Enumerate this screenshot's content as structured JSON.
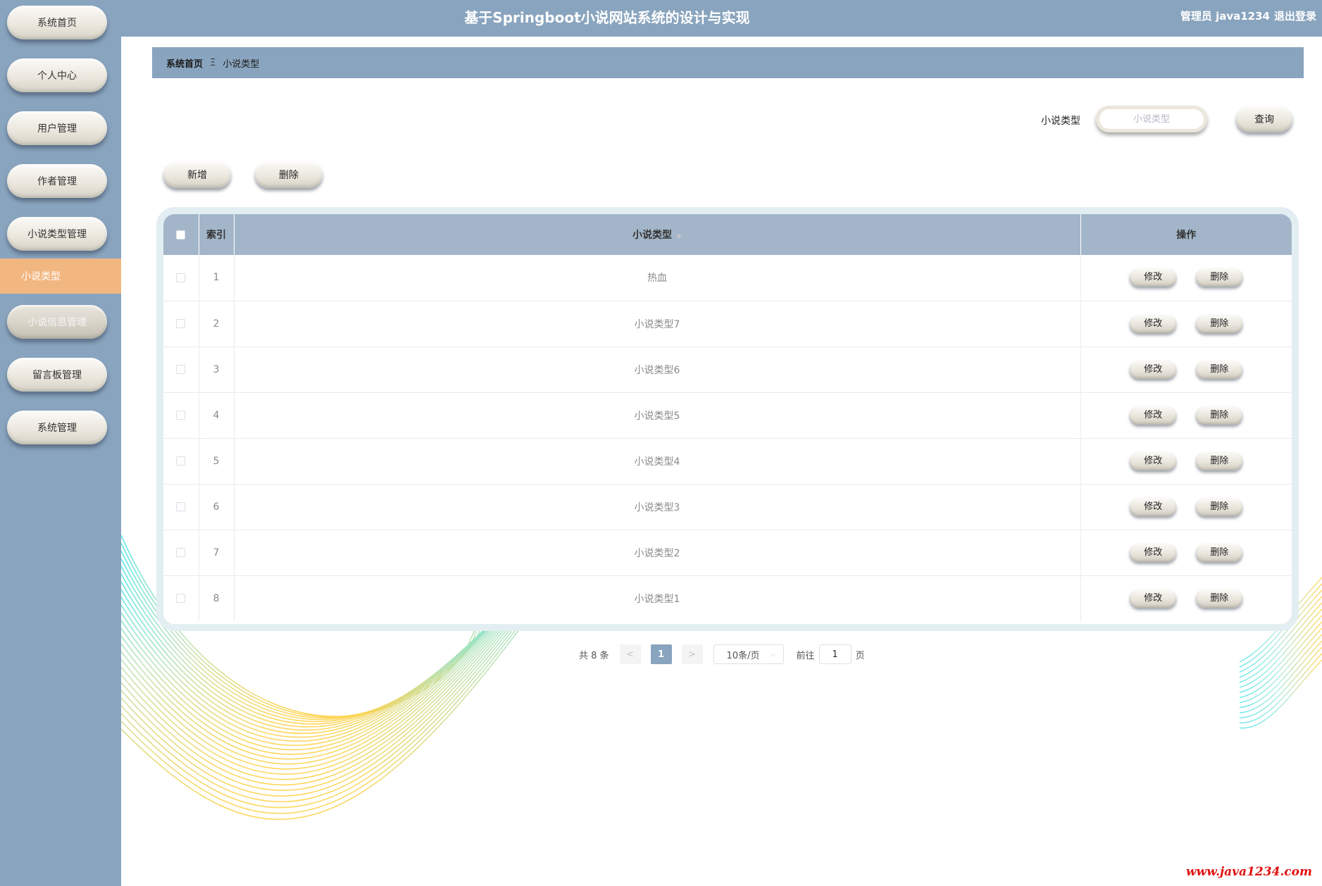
{
  "header": {
    "title": "基于Springboot小说网站系统的设计与实现",
    "user": "管理员 java1234",
    "logout": "退出登录"
  },
  "sidebar": {
    "items": [
      {
        "label": "系统首页"
      },
      {
        "label": "个人中心"
      },
      {
        "label": "用户管理"
      },
      {
        "label": "作者管理"
      },
      {
        "label": "小说类型管理"
      },
      {
        "label": "小说信息管理"
      },
      {
        "label": "留言板管理"
      },
      {
        "label": "系统管理"
      }
    ],
    "active_sub": "小说类型"
  },
  "breadcrumb": {
    "home": "系统首页",
    "separator": "Ξ",
    "current": "小说类型"
  },
  "search": {
    "label": "小说类型",
    "placeholder": "小说类型",
    "value": "",
    "button": "查询"
  },
  "actions": {
    "add": "新增",
    "delete": "删除"
  },
  "table": {
    "headers": {
      "index": "索引",
      "type": "小说类型",
      "ops": "操作"
    },
    "rows": [
      {
        "index": "1",
        "type": "热血"
      },
      {
        "index": "2",
        "type": "小说类型7"
      },
      {
        "index": "3",
        "type": "小说类型6"
      },
      {
        "index": "4",
        "type": "小说类型5"
      },
      {
        "index": "5",
        "type": "小说类型4"
      },
      {
        "index": "6",
        "type": "小说类型3"
      },
      {
        "index": "7",
        "type": "小说类型2"
      },
      {
        "index": "8",
        "type": "小说类型1"
      }
    ],
    "edit_label": "修改",
    "delete_label": "删除"
  },
  "pagination": {
    "total": "共 8 条",
    "prev": "<",
    "current": "1",
    "next": ">",
    "page_size": "10条/页",
    "goto_label": "前往",
    "goto_value": "1",
    "page_suffix": "页"
  },
  "watermark": "www.java1234.com",
  "colors": {
    "primary": "#89a4be",
    "active": "#f2b680",
    "table_header": "#a3b6c9",
    "watermark": "#e01010"
  }
}
